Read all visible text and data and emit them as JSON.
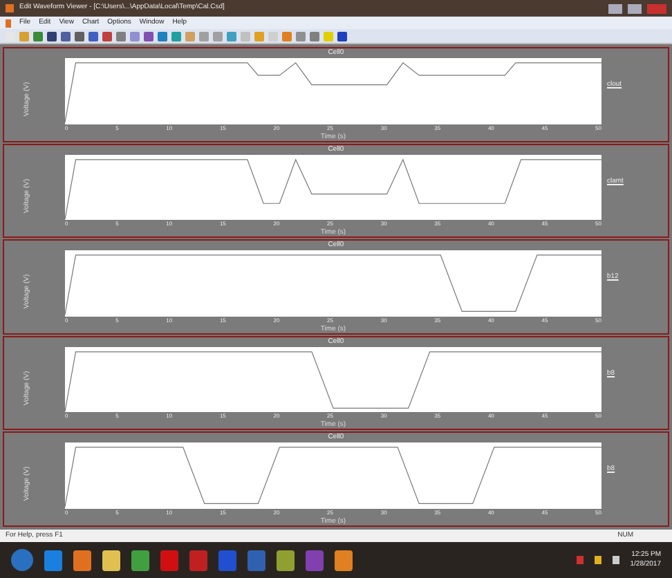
{
  "window": {
    "title": "Edit Waveform Viewer - [C:\\Users\\...\\AppData\\Local\\Temp\\Cal.Csd]"
  },
  "menu": [
    "File",
    "Edit",
    "View",
    "Chart",
    "Options",
    "Window",
    "Help"
  ],
  "panels": [
    {
      "title": "Cell0",
      "ylabel": "Voltage (V)",
      "xlabel": "Time (s)",
      "legend": "clout",
      "xticks": [
        "0",
        "5",
        "10",
        "15",
        "20",
        "25",
        "30",
        "35",
        "40",
        "45",
        "50"
      ]
    },
    {
      "title": "Cell0",
      "ylabel": "Voltage (V)",
      "xlabel": "Time (s)",
      "legend": "clamt",
      "xticks": [
        "0",
        "5",
        "10",
        "15",
        "20",
        "25",
        "30",
        "35",
        "40",
        "45",
        "50"
      ]
    },
    {
      "title": "Cell0",
      "ylabel": "Voltage (V)",
      "xlabel": "Time (s)",
      "legend": "b12",
      "xticks": [
        "0",
        "5",
        "10",
        "15",
        "20",
        "25",
        "30",
        "35",
        "40",
        "45",
        "50"
      ]
    },
    {
      "title": "Cell0",
      "ylabel": "Voltage (V)",
      "xlabel": "Time (s)",
      "legend": "b8",
      "xticks": [
        "0",
        "5",
        "10",
        "15",
        "20",
        "25",
        "30",
        "35",
        "40",
        "45",
        "50"
      ]
    },
    {
      "title": "Cell0",
      "ylabel": "Voltage (V)",
      "xlabel": "Time (s)",
      "legend": "b8",
      "xticks": [
        "0",
        "5",
        "10",
        "15",
        "20",
        "25",
        "30",
        "35",
        "40",
        "45",
        "50"
      ]
    }
  ],
  "status_bar": {
    "help": "For Help, press F1",
    "mode": "NUM"
  },
  "taskbar": {
    "time": "12:25 PM",
    "date": "1/28/2017"
  }
}
